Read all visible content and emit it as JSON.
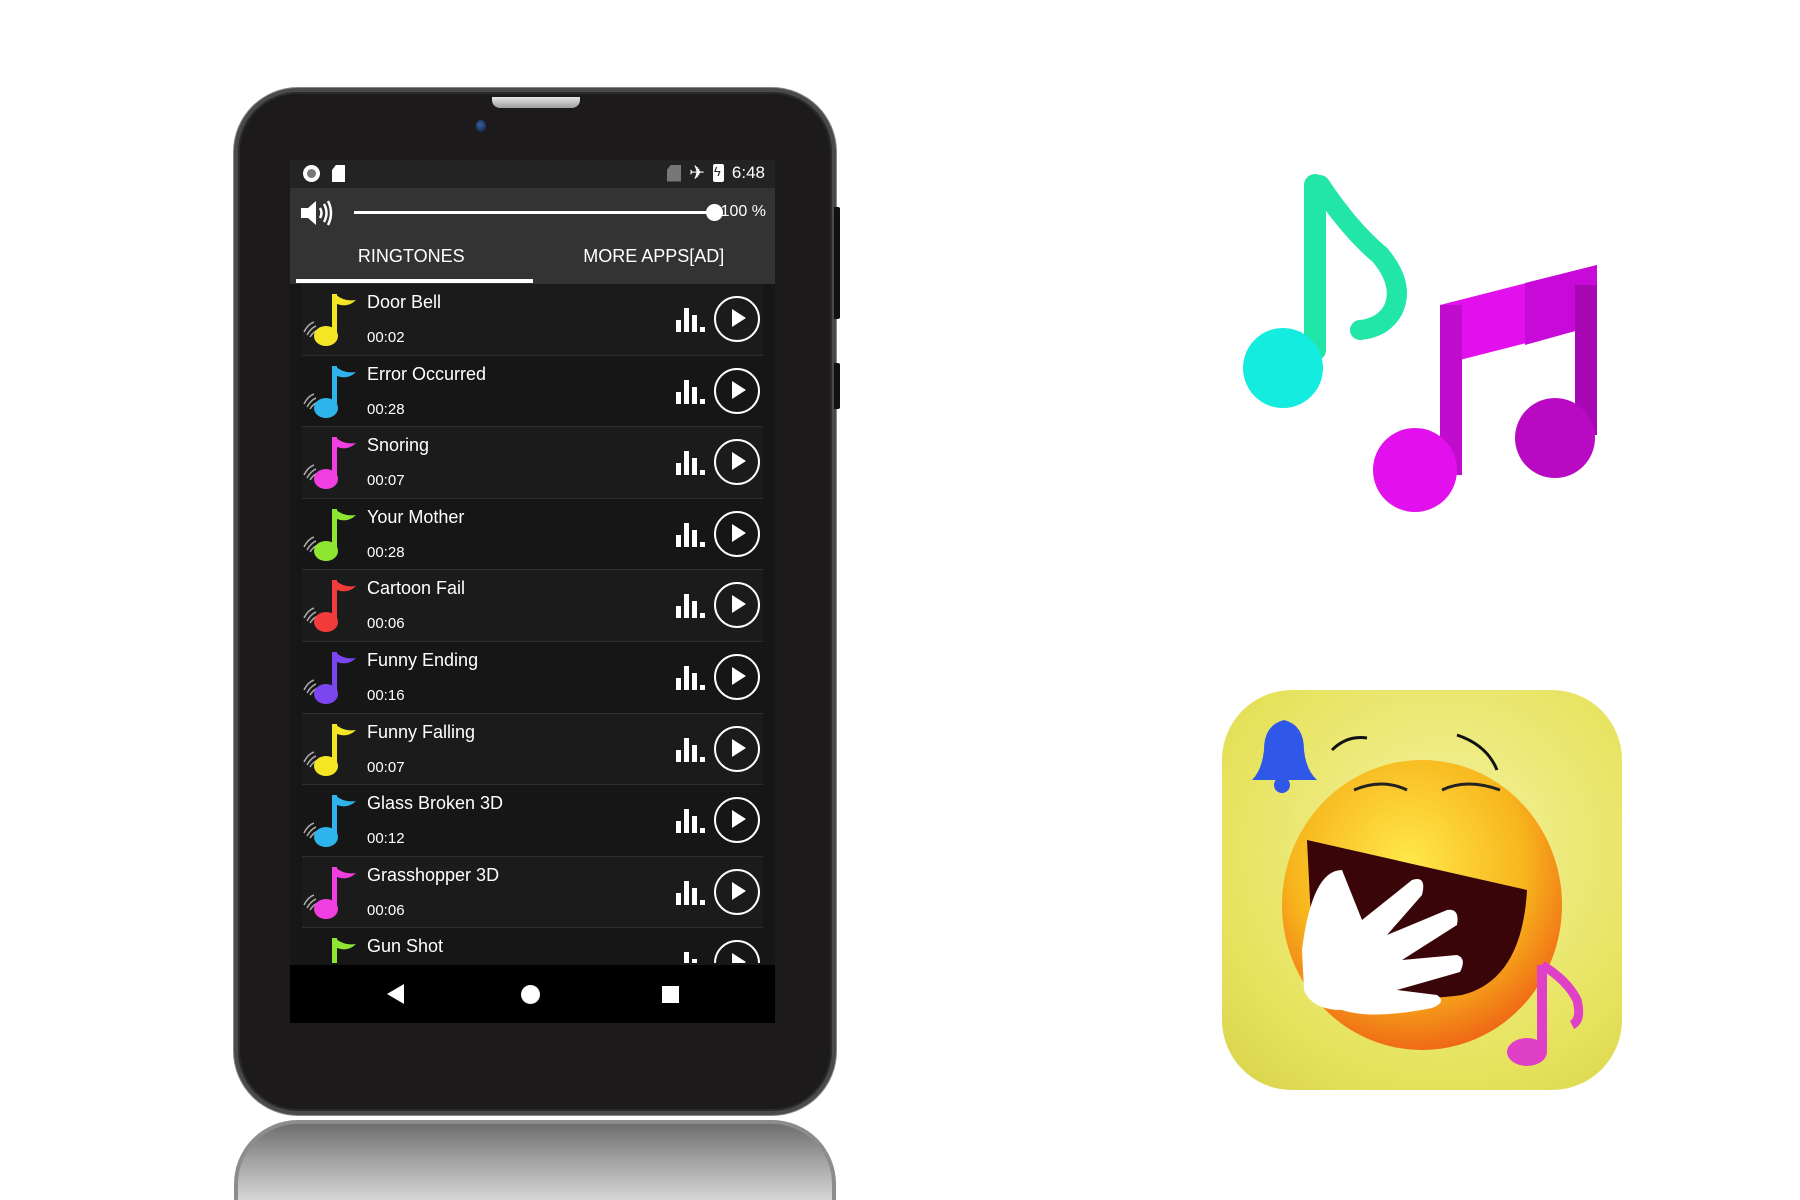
{
  "status_bar": {
    "left_icons": [
      "record-icon",
      "sd-card-icon"
    ],
    "right_icons": [
      "no-sim-icon",
      "airplane-icon",
      "battery-charging-icon"
    ],
    "time": "6:48"
  },
  "volume": {
    "icon": "speaker-icon",
    "level_percent": 100,
    "label": "100 %"
  },
  "tabs": [
    {
      "label": "RINGTONES",
      "active": true
    },
    {
      "label": "MORE APPS[AD]",
      "active": false
    }
  ],
  "ringtones": [
    {
      "title": "Door Bell",
      "duration": "00:02",
      "color": "#f5e625"
    },
    {
      "title": "Error Occurred",
      "duration": "00:28",
      "color": "#2fb3ec"
    },
    {
      "title": "Snoring",
      "duration": "00:07",
      "color": "#f03ee0"
    },
    {
      "title": "Your Mother",
      "duration": "00:28",
      "color": "#8ee632"
    },
    {
      "title": "Cartoon Fail",
      "duration": "00:06",
      "color": "#f23c3c"
    },
    {
      "title": "Funny Ending",
      "duration": "00:16",
      "color": "#7b45f0"
    },
    {
      "title": "Funny Falling",
      "duration": "00:07",
      "color": "#f5e625"
    },
    {
      "title": "Glass Broken 3D",
      "duration": "00:12",
      "color": "#2fb3ec"
    },
    {
      "title": "Grasshopper 3D",
      "duration": "00:06",
      "color": "#f03ee0"
    },
    {
      "title": "Gun Shot",
      "duration": "",
      "color": "#8ee632"
    }
  ],
  "nav_bar": {
    "buttons": [
      "back-icon",
      "home-icon",
      "recents-icon"
    ]
  },
  "artwork": {
    "music_notes_colors": {
      "eighth_note": "#22e6a8",
      "eighth_head": "#14ecdf",
      "beamed": "#e110ec",
      "beamed_dark": "#b80ac2"
    },
    "app_icon": {
      "bg": "#e8e46a",
      "bell": "#2f57e8",
      "note": "#e040c8",
      "face": "#f5c518"
    }
  }
}
